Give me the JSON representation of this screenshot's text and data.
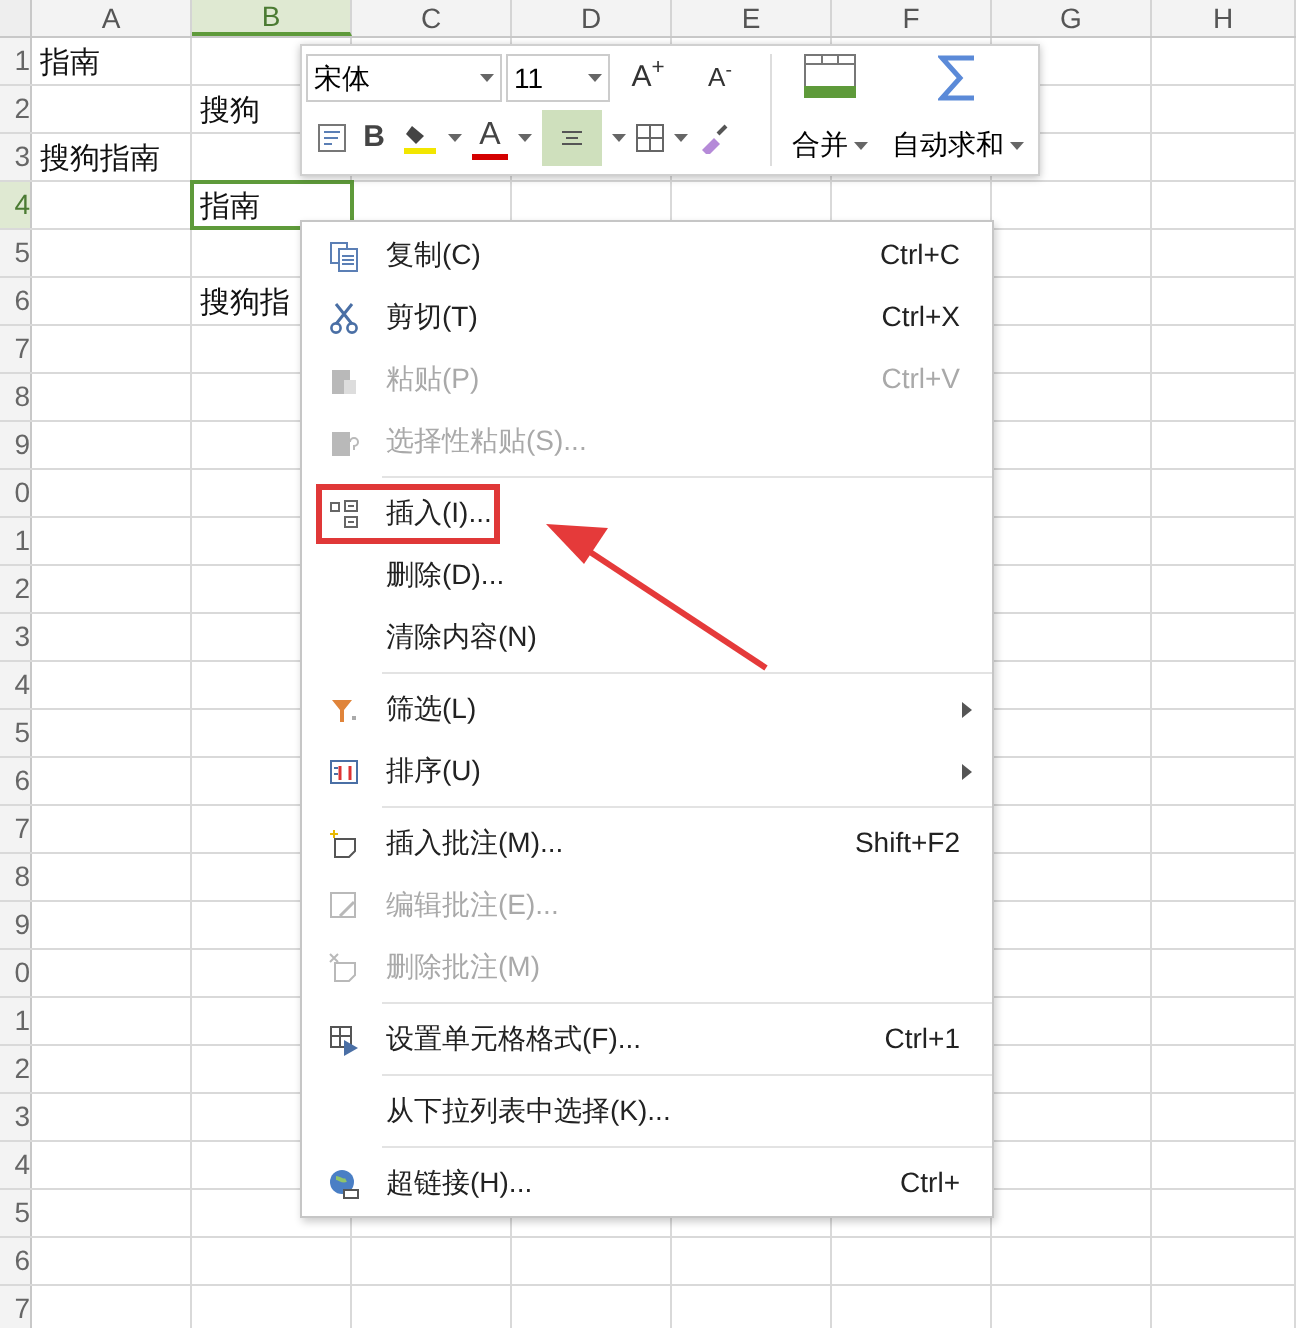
{
  "spreadsheet": {
    "columns": [
      {
        "label": "A",
        "selected": false
      },
      {
        "label": "B",
        "selected": true
      },
      {
        "label": "C",
        "selected": false
      },
      {
        "label": "D",
        "selected": false
      },
      {
        "label": "E",
        "selected": false
      },
      {
        "label": "F",
        "selected": false
      },
      {
        "label": "G",
        "selected": false
      },
      {
        "label": "H",
        "selected": false
      }
    ],
    "rows": [
      {
        "label": "1",
        "selected": false,
        "col_a": "指南"
      },
      {
        "label": "2",
        "selected": false,
        "col_b": "搜狗"
      },
      {
        "label": "3",
        "selected": false,
        "col_a": "搜狗指南"
      },
      {
        "label": "4",
        "selected": true,
        "col_b": "指南"
      },
      {
        "label": "5",
        "selected": false
      },
      {
        "label": "6",
        "selected": false,
        "col_b": "搜狗指"
      },
      {
        "label": "7",
        "selected": false
      },
      {
        "label": "8",
        "selected": false
      },
      {
        "label": "9",
        "selected": false
      },
      {
        "label": "0",
        "selected": false
      },
      {
        "label": "1",
        "selected": false
      },
      {
        "label": "2",
        "selected": false
      },
      {
        "label": "3",
        "selected": false
      },
      {
        "label": "4",
        "selected": false
      },
      {
        "label": "5",
        "selected": false
      },
      {
        "label": "6",
        "selected": false
      },
      {
        "label": "7",
        "selected": false
      },
      {
        "label": "8",
        "selected": false
      },
      {
        "label": "9",
        "selected": false
      },
      {
        "label": "0",
        "selected": false
      },
      {
        "label": "1",
        "selected": false
      },
      {
        "label": "2",
        "selected": false
      },
      {
        "label": "3",
        "selected": false
      },
      {
        "label": "4",
        "selected": false
      },
      {
        "label": "5",
        "selected": false
      },
      {
        "label": "6",
        "selected": false
      },
      {
        "label": "7",
        "selected": false
      }
    ]
  },
  "mini_toolbar": {
    "font": "宋体",
    "size": "11",
    "grow_font": "A$^{+}$",
    "shrink_font": "A$^{-}$",
    "bold": "B",
    "font_color": "A",
    "align_center_on": true,
    "merge": "合并",
    "autosum": "自动求和"
  },
  "context_menu": {
    "items": [
      {
        "kind": "item",
        "label": "复制(C)",
        "shortcut": "Ctrl+C",
        "disabled": false
      },
      {
        "kind": "item",
        "label": "剪切(T)",
        "shortcut": "Ctrl+X",
        "disabled": false
      },
      {
        "kind": "item",
        "label": "粘贴(P)",
        "shortcut": "Ctrl+V",
        "disabled": true
      },
      {
        "kind": "item",
        "label": "选择性粘贴(S)...",
        "disabled": true
      },
      {
        "kind": "separator"
      },
      {
        "kind": "item",
        "label": "插入(I)...",
        "disabled": false,
        "highlighted": true
      },
      {
        "kind": "item",
        "label": "删除(D)...",
        "disabled": false
      },
      {
        "kind": "item",
        "label": "清除内容(N)",
        "disabled": false
      },
      {
        "kind": "separator"
      },
      {
        "kind": "submenu",
        "label": "筛选(L)",
        "disabled": false
      },
      {
        "kind": "submenu",
        "label": "排序(U)",
        "disabled": false
      },
      {
        "kind": "separator"
      },
      {
        "kind": "item",
        "label": "插入批注(M)...",
        "shortcut": "Shift+F2",
        "disabled": false
      },
      {
        "kind": "item",
        "label": "编辑批注(E)...",
        "disabled": true
      },
      {
        "kind": "item",
        "label": "删除批注(M)",
        "disabled": true
      },
      {
        "kind": "separator"
      },
      {
        "kind": "item",
        "label": "设置单元格格式(F)...",
        "shortcut": "Ctrl+1",
        "disabled": false
      },
      {
        "kind": "separator"
      },
      {
        "kind": "item",
        "label": "从下拉列表中选择(K)...",
        "disabled": false
      },
      {
        "kind": "separator"
      },
      {
        "kind": "item",
        "label": "超链接(H)...",
        "shortcut": "Ctrl+",
        "disabled": false
      }
    ]
  }
}
